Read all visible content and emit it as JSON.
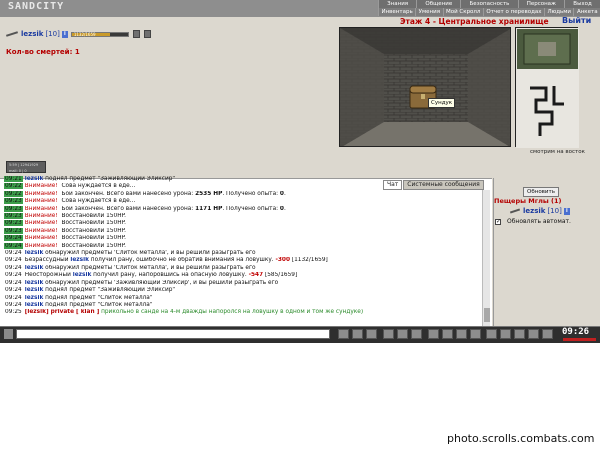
{
  "app": {
    "logo": "SANDCITY"
  },
  "nav": {
    "row1": [
      "Знания",
      "Общение",
      "Безопасность",
      "Персонаж",
      "Выход"
    ],
    "row2": [
      "Инвентарь",
      "Умения",
      "Мой Скролл",
      "Отчет о переводах",
      "Людьми",
      "Анкета"
    ]
  },
  "player": {
    "nick": "lezsik",
    "level": "[10]",
    "info_badge": "i",
    "hp_text": "1132/1659",
    "hp_fraction": 0.68
  },
  "deaths_text": "Кол-во смертей: 1",
  "location": {
    "title": "Этаж 4 - Центральное хранилище",
    "exit_label": "Выйти"
  },
  "dungeon": {
    "chest_label": "Сундук",
    "compass_text": "смотрим на восток"
  },
  "stats_panel": [
    "5:59 | 12941929",
    "mail: 0 | 0"
  ],
  "chat": {
    "tabs": [
      "Чат",
      "Системные сообщения"
    ],
    "lines": [
      {
        "time": "09:21",
        "hl": true,
        "parts": [
          {
            "c": "n",
            "t": "lezsik"
          },
          {
            "c": "x",
            "t": " поднял предмет \"Заживляющий Эликсир\""
          }
        ]
      },
      {
        "time": "09:22",
        "hl": true,
        "parts": [
          {
            "c": "w",
            "t": "Внимание!"
          },
          {
            "c": "x",
            "t": " Сова нуждается в еде..."
          }
        ]
      },
      {
        "time": "09:22",
        "hl": true,
        "parts": [
          {
            "c": "w",
            "t": "Внимание!"
          },
          {
            "c": "x",
            "t": " Бой закончен. Всего вами нанесено урона: "
          },
          {
            "c": "b",
            "t": "2535 HP"
          },
          {
            "c": "x",
            "t": ". Получено опыта: "
          },
          {
            "c": "b",
            "t": "0"
          },
          {
            "c": "x",
            "t": "."
          }
        ]
      },
      {
        "time": "09:23",
        "hl": true,
        "parts": [
          {
            "c": "w",
            "t": "Внимание!"
          },
          {
            "c": "x",
            "t": " Сова нуждается в еде..."
          }
        ]
      },
      {
        "time": "09:23",
        "hl": true,
        "parts": [
          {
            "c": "w",
            "t": "Внимание!"
          },
          {
            "c": "x",
            "t": " Бой закончен. Всего вами нанесено урона: "
          },
          {
            "c": "b",
            "t": "1171 HP"
          },
          {
            "c": "x",
            "t": ". Получено опыта: "
          },
          {
            "c": "b",
            "t": "0"
          },
          {
            "c": "x",
            "t": "."
          }
        ]
      },
      {
        "time": "09:23",
        "hl": true,
        "parts": [
          {
            "c": "w",
            "t": "Внимание!"
          },
          {
            "c": "x",
            "t": " Восстановили 150HP."
          }
        ]
      },
      {
        "time": "09:23",
        "hl": true,
        "parts": [
          {
            "c": "w",
            "t": "Внимание!"
          },
          {
            "c": "x",
            "t": " Восстановили 150HP."
          }
        ]
      },
      {
        "time": "09:23",
        "hl": true,
        "parts": [
          {
            "c": "w",
            "t": "Внимание!"
          },
          {
            "c": "x",
            "t": " Восстановили 150HP."
          }
        ]
      },
      {
        "time": "09:24",
        "hl": true,
        "parts": [
          {
            "c": "w",
            "t": "Внимание!"
          },
          {
            "c": "x",
            "t": " Восстановили 150HP."
          }
        ]
      },
      {
        "time": "09:24",
        "hl": true,
        "parts": [
          {
            "c": "w",
            "t": "Внимание!"
          },
          {
            "c": "x",
            "t": " Восстановили 150HP."
          }
        ]
      },
      {
        "time": "09:24",
        "hl": false,
        "parts": [
          {
            "c": "n",
            "t": "lezsik"
          },
          {
            "c": "x",
            "t": " обнаружил предметы 'Слиток металла', и вы решили разыграть его"
          }
        ]
      },
      {
        "time": "09:24",
        "hl": false,
        "parts": [
          {
            "c": "x",
            "t": "Безрассудный "
          },
          {
            "c": "n",
            "t": "lezsik"
          },
          {
            "c": "x",
            "t": " получил рану, ошибочно не обратив внимания на ловушку. "
          },
          {
            "c": "d",
            "t": "-300"
          },
          {
            "c": "x",
            "t": " [1132/1659]"
          }
        ]
      },
      {
        "time": "09:24",
        "hl": false,
        "parts": [
          {
            "c": "n",
            "t": "lezsik"
          },
          {
            "c": "x",
            "t": " обнаружил предметы 'Слиток металла', и вы решили разыграть его"
          }
        ]
      },
      {
        "time": "09:24",
        "hl": false,
        "parts": [
          {
            "c": "x",
            "t": "Неосторожный "
          },
          {
            "c": "n",
            "t": "lezsik"
          },
          {
            "c": "x",
            "t": " получил рану, напоровшись на опасную ловушку. "
          },
          {
            "c": "d",
            "t": "-547"
          },
          {
            "c": "x",
            "t": " [585/1659]"
          }
        ]
      },
      {
        "time": "09:24",
        "hl": false,
        "parts": [
          {
            "c": "n",
            "t": "lezsik"
          },
          {
            "c": "x",
            "t": " обнаружил предметы 'Заживляющий Эликсир', и вы решили разыграть его"
          }
        ]
      },
      {
        "time": "09:24",
        "hl": false,
        "parts": [
          {
            "c": "n",
            "t": "lezsik"
          },
          {
            "c": "x",
            "t": " поднял предмет \"Заживляющий Эликсир\""
          }
        ]
      },
      {
        "time": "09:24",
        "hl": false,
        "parts": [
          {
            "c": "n",
            "t": "lezsik"
          },
          {
            "c": "x",
            "t": " поднял предмет \"Слиток металла\""
          }
        ]
      },
      {
        "time": "09:24",
        "hl": false,
        "parts": [
          {
            "c": "n",
            "t": "lezsik"
          },
          {
            "c": "x",
            "t": " поднял предмет \"Слиток металла\""
          }
        ]
      },
      {
        "time": "09:25",
        "hl": false,
        "parts": [
          {
            "c": "p",
            "t": "[lezsik] private [ klan ]"
          },
          {
            "c": "g",
            "t": " прикольно в санде на 4-м дважды напоролся на ловушку в одном и том же сундуке)"
          }
        ]
      }
    ]
  },
  "right_panel": {
    "refresh_label": "Обновить",
    "caves_title": "Пещеры Мглы (1)",
    "user_nick": "lezsik",
    "user_level": "[10]",
    "auto_update_label": "Обновлять автомат."
  },
  "toolbar": {
    "clock": "09:26"
  },
  "watermark": "photo.scrolls.combats.com",
  "colors": {
    "frame_bg": "#dcd8cf",
    "alert_red": "#c00000",
    "nick_blue": "#1a3aa0",
    "time_highlight": "#3c9e4a"
  }
}
